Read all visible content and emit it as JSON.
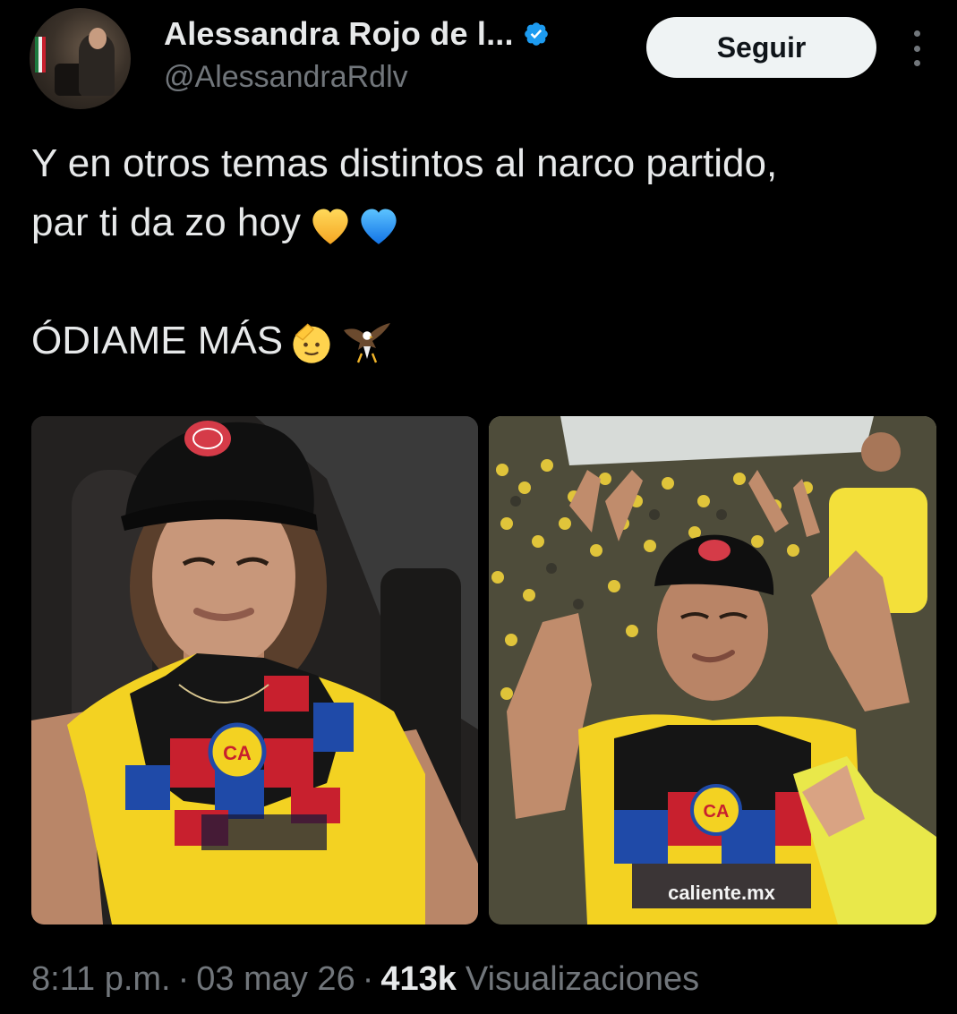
{
  "author": {
    "display_name": "Alessandra Rojo de l...",
    "handle": "@AlessandraRdlv",
    "verified": true,
    "badge_color": "#1d9bf0"
  },
  "header": {
    "follow_label": "Seguir"
  },
  "tweet": {
    "lines": [
      "Y en otros temas distintos al narco partido,",
      "par ti da zo hoy",
      "ÓDIAME MÁS"
    ],
    "line2_emoji": [
      "yellow-heart",
      "blue-heart"
    ],
    "line3_emoji": [
      "saluting-face",
      "eagle"
    ]
  },
  "media": [
    {
      "name": "photo-selfie-car",
      "jersey": "Club América"
    },
    {
      "name": "photo-stadium",
      "jersey": "Club América"
    }
  ],
  "meta": {
    "time": "8:11 p.m.",
    "separator": "·",
    "date": "03 may 26",
    "views_count": "413k",
    "views_label": "Visualizaciones"
  },
  "colors": {
    "background": "#000000",
    "text": "#e7e9ea",
    "muted": "#71767b",
    "jersey_yellow": "#f3d222",
    "jersey_blue": "#1f4aa8",
    "jersey_red": "#c8202e"
  }
}
